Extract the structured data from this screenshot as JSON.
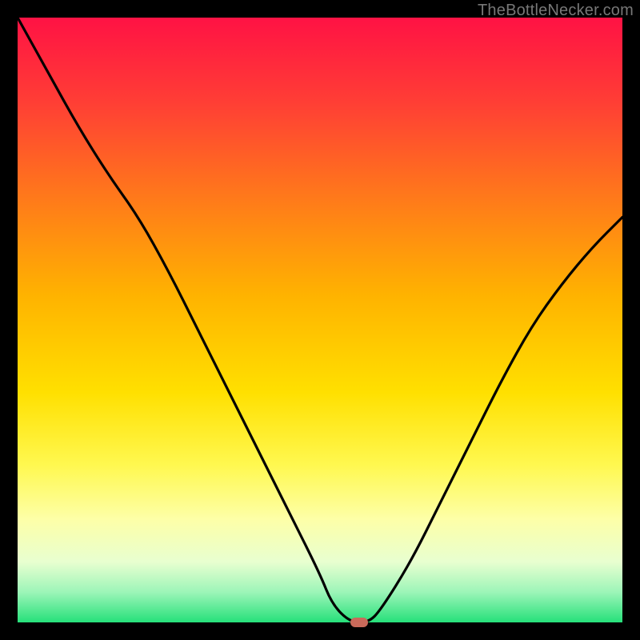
{
  "watermark": {
    "text": "TheBottleNecker.com"
  },
  "colors": {
    "background": "#000000",
    "curve": "#000000",
    "marker": "#c96a5a",
    "watermark": "#777777"
  },
  "chart_data": {
    "type": "line",
    "title": "",
    "xlabel": "",
    "ylabel": "",
    "xlim": [
      0,
      100
    ],
    "ylim": [
      0,
      100
    ],
    "x": [
      0,
      5,
      10,
      15,
      20,
      25,
      30,
      35,
      40,
      45,
      50,
      52,
      55,
      58,
      60,
      65,
      70,
      75,
      80,
      85,
      90,
      95,
      100
    ],
    "values": [
      100,
      91,
      82,
      74,
      67,
      58,
      48,
      38,
      28,
      18,
      8,
      3,
      0,
      0,
      2,
      10,
      20,
      30,
      40,
      49,
      56,
      62,
      67
    ],
    "marker": {
      "x": 56.5,
      "y": 0
    },
    "grid": false,
    "legend": null
  }
}
